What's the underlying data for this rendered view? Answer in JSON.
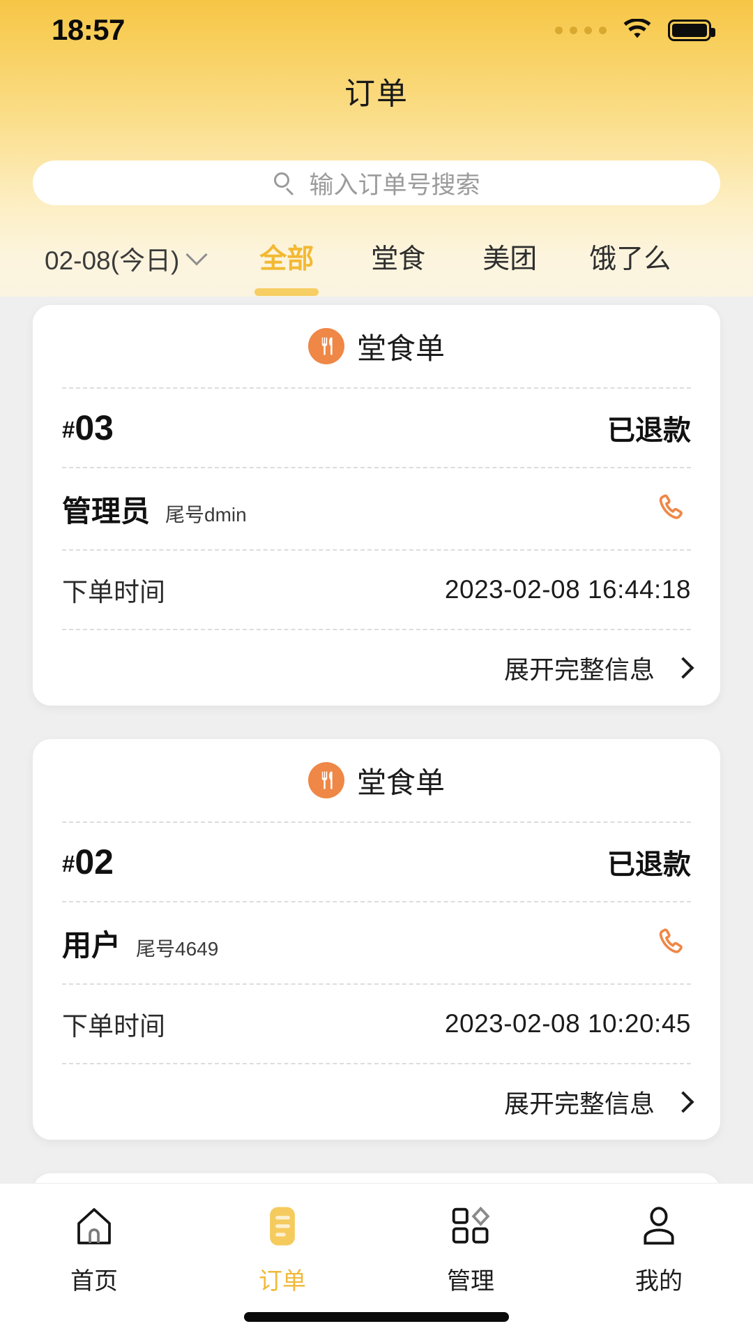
{
  "status_bar": {
    "time": "18:57",
    "signal_icon": "signal-dots-icon",
    "wifi_icon": "wifi-icon",
    "battery_icon": "battery-full-icon"
  },
  "header": {
    "title": "订单"
  },
  "search": {
    "placeholder": "输入订单号搜索",
    "icon": "search-icon"
  },
  "filters": {
    "date": {
      "label": "02-08(今日)",
      "chevron_icon": "chevron-down-icon"
    },
    "tabs": [
      {
        "label": "全部",
        "active": true
      },
      {
        "label": "堂食",
        "active": false
      },
      {
        "label": "美团",
        "active": false
      },
      {
        "label": "饿了么",
        "active": false
      }
    ],
    "active_tab": "全部",
    "accent_color": "#f2b932"
  },
  "labels": {
    "order_time": "下单时间",
    "expand_info": "展开完整信息",
    "chevron_right_icon": "chevron-right-icon",
    "phone_icon": "phone-icon",
    "cutlery_icon": "cutlery-icon"
  },
  "orders": [
    {
      "type": "堂食单",
      "number": "03",
      "hash": "#",
      "status": "已退款",
      "customer_name": "管理员",
      "customer_tail": "尾号dmin",
      "order_time_label": "下单时间",
      "order_time": "2023-02-08 16:44:18",
      "expand_label": "展开完整信息"
    },
    {
      "type": "堂食单",
      "number": "02",
      "hash": "#",
      "status": "已退款",
      "customer_name": "用户",
      "customer_tail": "尾号4649",
      "order_time_label": "下单时间",
      "order_time": "2023-02-08 10:20:45",
      "expand_label": "展开完整信息"
    },
    {
      "type": "堂食单",
      "number": "",
      "hash": "",
      "status": "",
      "customer_name": "",
      "customer_tail": "",
      "order_time_label": "",
      "order_time": "",
      "expand_label": ""
    }
  ],
  "bottom_nav": {
    "items": [
      {
        "label": "首页",
        "icon": "home-icon",
        "active": false
      },
      {
        "label": "订单",
        "icon": "order-list-icon",
        "active": true
      },
      {
        "label": "管理",
        "icon": "manage-grid-icon",
        "active": false
      },
      {
        "label": "我的",
        "icon": "user-profile-icon",
        "active": false
      }
    ]
  },
  "colors": {
    "brand_yellow": "#f6c545",
    "accent_orange": "#ef8746",
    "tab_active": "#f2b932",
    "page_bg": "#efefef",
    "card_bg": "#ffffff"
  }
}
